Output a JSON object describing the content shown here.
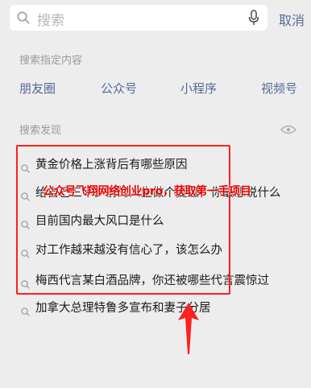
{
  "search": {
    "placeholder": "搜索",
    "cancel_label": "取消"
  },
  "specified": {
    "title": "搜索指定内容",
    "categories": [
      "朋友圈",
      "公众号",
      "小程序",
      "视频号"
    ]
  },
  "discovery": {
    "title": "搜索发现",
    "items": [
      "黄金价格上涨背后有哪些原因",
      "给自己三十岁前的人生做个复盘，你最想说什么",
      "目前国内最大风口是什么",
      "对工作越来越没有信心了，该怎么办",
      "梅西代言某白酒品牌，你还被哪些代言震惊过",
      "加拿大总理特鲁多宣布和妻子分居"
    ]
  },
  "annotation": {
    "watermark": "公众号飞翔网络创业pro，获取第一手项目",
    "color": "#ff1f1f"
  },
  "icons": [
    "search-icon",
    "mic-icon",
    "eye-toggle-icon",
    "arrow-up-icon"
  ],
  "colors": {
    "background": "#ededed",
    "link": "#576b95",
    "muted": "#9a9a9a"
  }
}
